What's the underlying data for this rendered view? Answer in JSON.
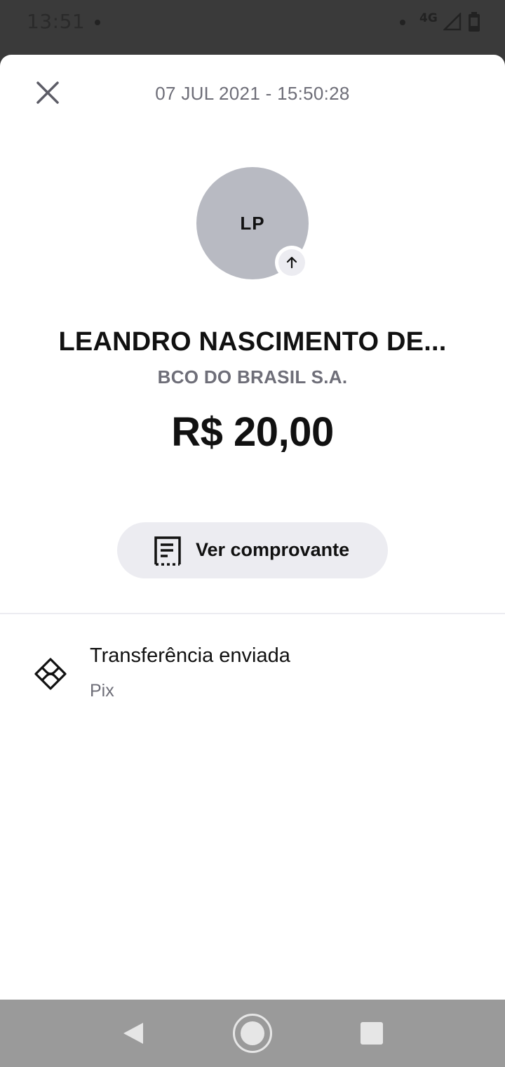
{
  "status_bar": {
    "time": "13:51",
    "network": "4G",
    "icons": [
      "signal-icon",
      "battery-icon"
    ]
  },
  "header": {
    "close_icon": "close-icon",
    "date": "07 JUL 2021 - 15:50:28"
  },
  "recipient": {
    "initials": "LP",
    "direction_icon": "arrow-up-icon",
    "name": "LEANDRO NASCIMENTO DE...",
    "bank": "BCO DO BRASIL S.A."
  },
  "transaction": {
    "amount": "R$ 20,00"
  },
  "actions": {
    "receipt_icon": "receipt-icon",
    "receipt_label": "Ver comprovante"
  },
  "details": {
    "icon": "pix-icon",
    "title": "Transferência enviada",
    "subtitle": "Pix"
  },
  "nav": {
    "icons": [
      "back-icon",
      "home-icon",
      "recents-icon"
    ]
  },
  "colors": {
    "background": "#ffffff",
    "avatar": "#b8bac2",
    "muted_text": "#6e6e78",
    "button_bg": "#ececf1",
    "status_bar": "#3a3a3a",
    "nav_bar": "#9a9a9a"
  }
}
